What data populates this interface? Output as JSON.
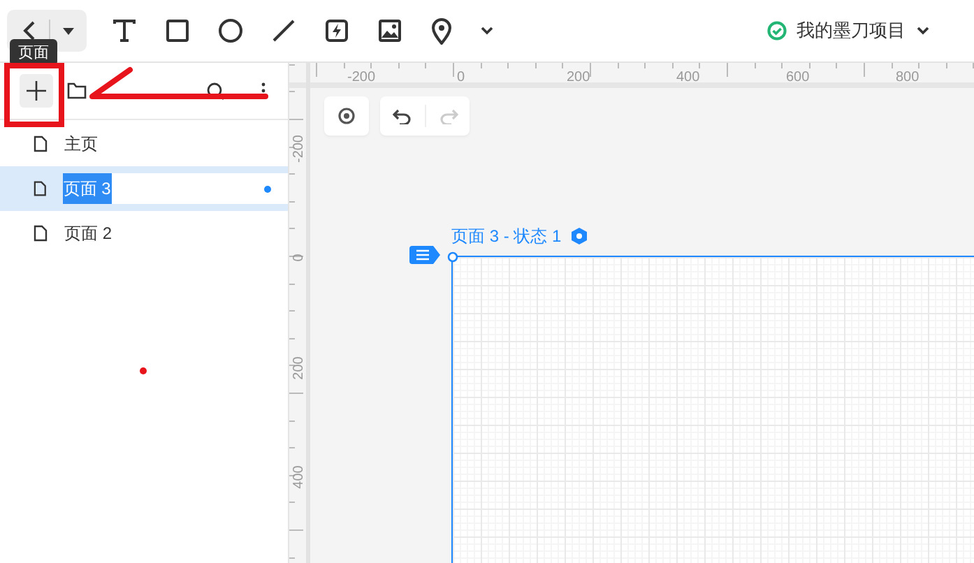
{
  "toolbar": {
    "project": {
      "name": "我的墨刀项目",
      "synced": true
    }
  },
  "tooltip": "页面",
  "pages": [
    {
      "name": "主页",
      "selected": false
    },
    {
      "name": "页面 3",
      "selected": true
    },
    {
      "name": "页面 2",
      "selected": false
    }
  ],
  "rulers": {
    "horizontal": [
      "-200",
      "0",
      "200",
      "400",
      "600",
      "800"
    ],
    "vertical": [
      "-200",
      "0",
      "200",
      "400"
    ]
  },
  "artboard": {
    "label": "页面 3 - 状态 1"
  }
}
